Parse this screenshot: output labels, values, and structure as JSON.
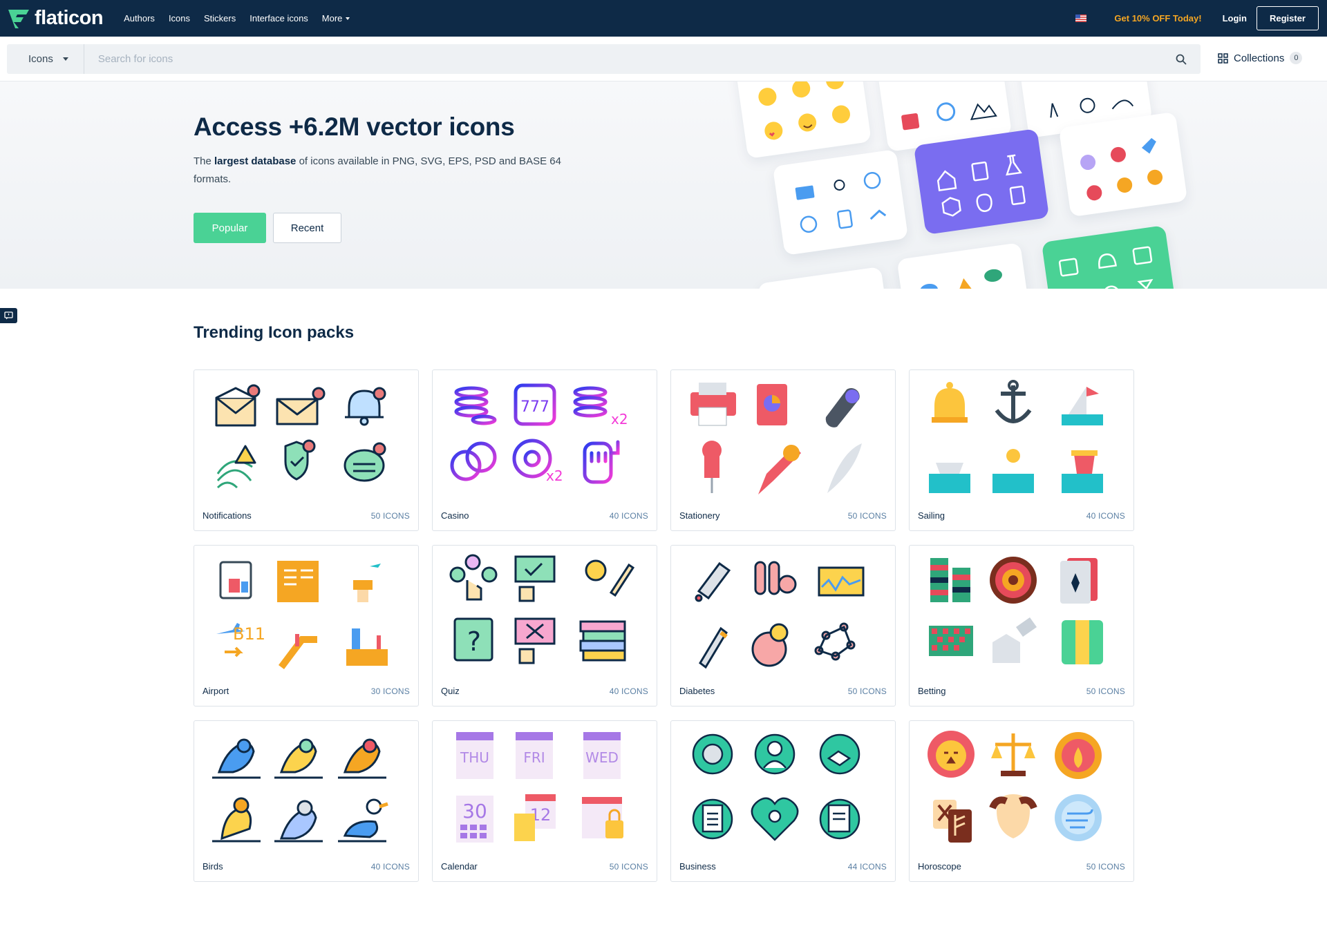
{
  "brand": {
    "name": "flaticon",
    "color": "#4ad295"
  },
  "nav": {
    "links": [
      "Authors",
      "Icons",
      "Stickers",
      "Interface icons"
    ],
    "more_label": "More",
    "promo": "Get 10% OFF Today!",
    "login": "Login",
    "register": "Register"
  },
  "search": {
    "type_label": "Icons",
    "placeholder": "Search for icons",
    "collections_label": "Collections",
    "collections_count": "0"
  },
  "hero": {
    "title": "Access +6.2M vector icons",
    "desc_pre": "The ",
    "desc_bold": "largest database",
    "desc_post": " of icons available in PNG, SVG, EPS, PSD and BASE 64 formats.",
    "btn_popular": "Popular",
    "btn_recent": "Recent"
  },
  "trending": {
    "title": "Trending Icon packs",
    "packs": [
      {
        "name": "Notifications",
        "count": "50 ICONS",
        "style": "lineal-color"
      },
      {
        "name": "Casino",
        "count": "40 ICONS",
        "style": "gradient-line"
      },
      {
        "name": "Stationery",
        "count": "50 ICONS",
        "style": "flat"
      },
      {
        "name": "Sailing",
        "count": "40 ICONS",
        "style": "flat"
      },
      {
        "name": "Airport",
        "count": "30 ICONS",
        "style": "flat"
      },
      {
        "name": "Quiz",
        "count": "40 ICONS",
        "style": "lineal-color"
      },
      {
        "name": "Diabetes",
        "count": "50 ICONS",
        "style": "lineal-color"
      },
      {
        "name": "Betting",
        "count": "50 ICONS",
        "style": "flat"
      },
      {
        "name": "Birds",
        "count": "40 ICONS",
        "style": "lineal-color"
      },
      {
        "name": "Calendar",
        "count": "50 ICONS",
        "style": "flat"
      },
      {
        "name": "Business",
        "count": "44 ICONS",
        "style": "lineal-color"
      },
      {
        "name": "Horoscope",
        "count": "50 ICONS",
        "style": "flat"
      }
    ]
  },
  "colors": {
    "navy": "#0e2a47",
    "green": "#4ad295",
    "purple": "#7a6df0",
    "promo": "#f5a623"
  }
}
